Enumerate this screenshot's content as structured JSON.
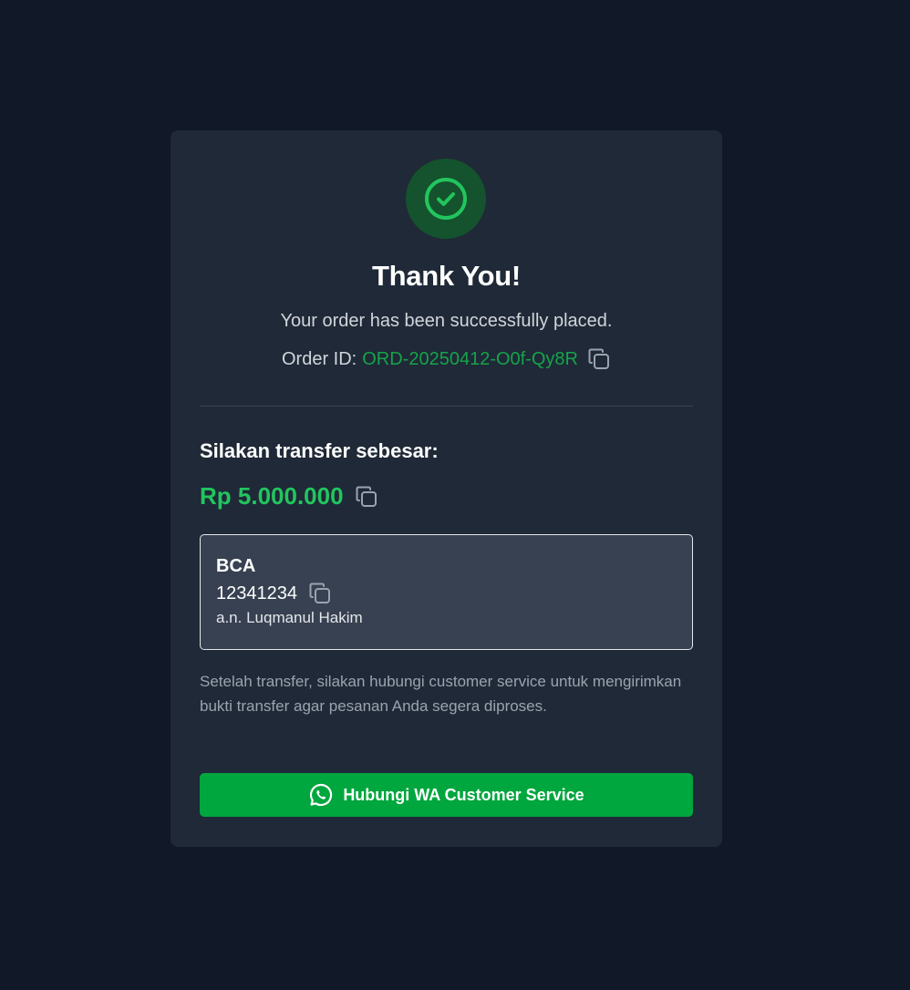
{
  "success": {
    "icon": "check-circle-icon",
    "title": "Thank You!",
    "subtitle": "Your order has been successfully placed."
  },
  "order": {
    "label": "Order ID:",
    "id": "ORD-20250412-O0f-Qy8R",
    "copy_icon": "copy-icon"
  },
  "payment": {
    "heading": "Silakan transfer sebesar:",
    "amount": "Rp 5.000.000",
    "copy_icon": "copy-icon"
  },
  "bank": {
    "name": "BCA",
    "account_number": "12341234",
    "account_holder": "a.n. Luqmanul Hakim",
    "copy_icon": "copy-icon"
  },
  "note": "Setelah transfer, silakan hubungi customer service untuk mengirimkan bukti transfer agar pesanan Anda segera diproses.",
  "contact_button": {
    "label": "Hubungi WA Customer Service",
    "icon": "whatsapp-icon"
  },
  "colors": {
    "page_background": "#111827",
    "card_background": "#1f2937",
    "accent_green": "#22c55e",
    "order_id_green": "#16a34a",
    "button_green": "#00a63e",
    "success_circle": "#14532d"
  }
}
